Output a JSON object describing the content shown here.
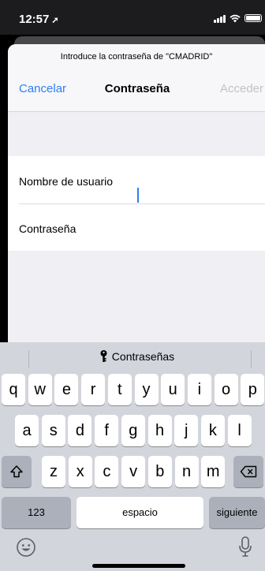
{
  "status_bar": {
    "time": "12:57"
  },
  "sheet": {
    "prompt": "Introduce la contraseña de \"CMADRID\"",
    "cancel_label": "Cancelar",
    "title": "Contraseña",
    "access_label": "Acceder"
  },
  "form": {
    "username_label": "Nombre de usuario",
    "password_label": "Contraseña"
  },
  "keyboard": {
    "suggestion": "Contraseñas",
    "row1": [
      "q",
      "w",
      "e",
      "r",
      "t",
      "y",
      "u",
      "i",
      "o",
      "p"
    ],
    "row2": [
      "a",
      "s",
      "d",
      "f",
      "g",
      "h",
      "j",
      "k",
      "l"
    ],
    "row3": [
      "z",
      "x",
      "c",
      "v",
      "b",
      "n",
      "m"
    ],
    "numbers_label": "123",
    "space_label": "espacio",
    "return_label": "siguiente"
  },
  "colors": {
    "accent": "#2f7df6",
    "disabled": "#c2c2c6",
    "keyboard_bg": "#d2d5db"
  }
}
